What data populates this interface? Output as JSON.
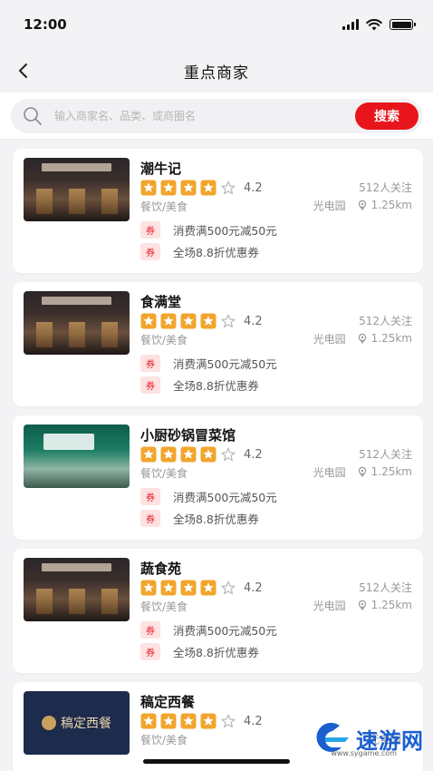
{
  "status_bar": {
    "time": "12:00"
  },
  "nav": {
    "title": "重点商家",
    "back_icon": "chevron-left-icon"
  },
  "search": {
    "placeholder": "输入商家名、品类、或商圈名",
    "button_label": "搜索"
  },
  "colors": {
    "accent": "#e8151c",
    "star": "#f2a52c",
    "coupon_bg": "#fde2e2"
  },
  "merchants": [
    {
      "name": "潮牛记",
      "rating": "4.2",
      "stars_filled": 4,
      "followers": "512人关注",
      "category": "餐饮/美食",
      "area": "光电园",
      "distance": "1.25km",
      "coupons": [
        {
          "tag": "券",
          "text": "消费满500元减50元"
        },
        {
          "tag": "券",
          "text": "全场8.8折优惠券"
        }
      ]
    },
    {
      "name": "食满堂",
      "rating": "4.2",
      "stars_filled": 4,
      "followers": "512人关注",
      "category": "餐饮/美食",
      "area": "光电园",
      "distance": "1.25km",
      "coupons": [
        {
          "tag": "券",
          "text": "消费满500元减50元"
        },
        {
          "tag": "券",
          "text": "全场8.8折优惠券"
        }
      ]
    },
    {
      "name": "小厨砂锅冒菜馆",
      "rating": "4.2",
      "stars_filled": 4,
      "followers": "512人关注",
      "category": "餐饮/美食",
      "area": "光电园",
      "distance": "1.25km",
      "coupons": [
        {
          "tag": "券",
          "text": "消费满500元减50元"
        },
        {
          "tag": "券",
          "text": "全场8.8折优惠券"
        }
      ]
    },
    {
      "name": "蔬食苑",
      "rating": "4.2",
      "stars_filled": 4,
      "followers": "512人关注",
      "category": "餐饮/美食",
      "area": "光电园",
      "distance": "1.25km",
      "coupons": [
        {
          "tag": "券",
          "text": "消费满500元减50元"
        },
        {
          "tag": "券",
          "text": "全场8.8折优惠券"
        }
      ]
    },
    {
      "name": "稿定西餐",
      "rating": "4.2",
      "stars_filled": 4,
      "followers": "",
      "category": "餐饮/美食",
      "area": "光电园",
      "distance": "",
      "thumb_text": "稿定西餐",
      "coupons": []
    }
  ],
  "watermark": {
    "text": "速游网",
    "sub": "www.sygame.com"
  }
}
